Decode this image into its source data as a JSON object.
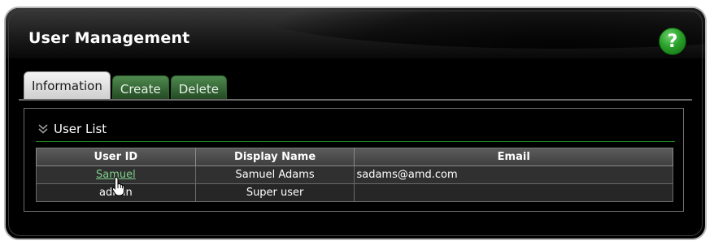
{
  "header": {
    "title": "User Management",
    "help_label": "?"
  },
  "tabs": [
    {
      "label": "Information",
      "active": true
    },
    {
      "label": "Create",
      "active": false
    },
    {
      "label": "Delete",
      "active": false
    }
  ],
  "section": {
    "title": "User List",
    "icon": "double-chevron-down-icon"
  },
  "table": {
    "columns": [
      "User ID",
      "Display Name",
      "Email"
    ],
    "rows": [
      {
        "user_id": "Samuel",
        "display_name": "Samuel Adams",
        "email": "sadams@amd.com"
      },
      {
        "user_id": "admin",
        "display_name": "Super user",
        "email": ""
      }
    ]
  },
  "colors": {
    "accent_green": "#2aa12a",
    "link_green": "#7fd18a",
    "panel_bg": "#000000"
  },
  "cursor": {
    "icon": "hand-pointer-icon"
  }
}
